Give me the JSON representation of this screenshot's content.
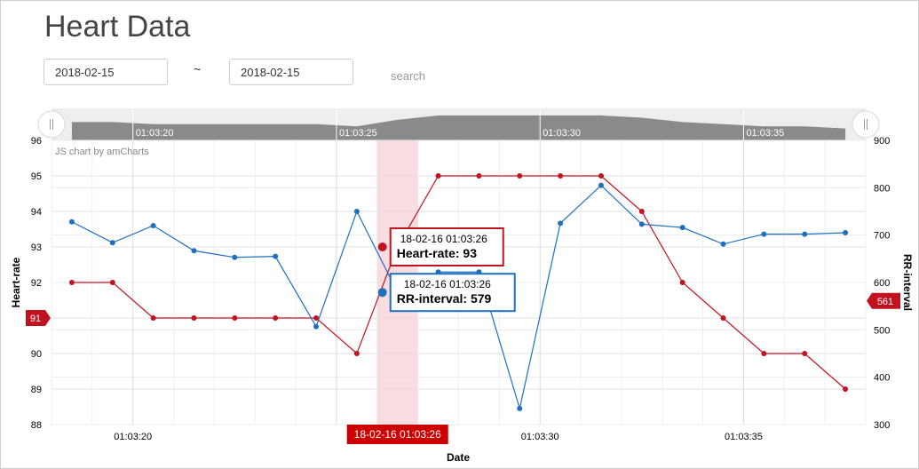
{
  "page": {
    "title": "Heart Data"
  },
  "filters": {
    "start_date": "2018-02-15",
    "end_date": "2018-02-15",
    "separator": "~",
    "search_label": "search"
  },
  "colors": {
    "heart_rate": "#c1121f",
    "rr_interval": "#1f6fbf",
    "scrollbar_fill": "#8a8a8a",
    "scrollbar_bg": "#eeeeee",
    "cursor_band": "#f6d5d8",
    "grid": "#e0e0e0"
  },
  "chart_data": {
    "type": "line",
    "credit": "JS chart by amCharts",
    "xlabel": "Date",
    "y_left_label": "Heart-rate",
    "y_right_label": "RR-interval",
    "ylim_left": [
      88,
      96
    ],
    "ylim_right": [
      300,
      900
    ],
    "y_left_ticks": [
      88,
      89,
      90,
      91,
      92,
      93,
      94,
      95,
      96
    ],
    "y_right_ticks": [
      300,
      400,
      500,
      600,
      700,
      800,
      900
    ],
    "x_tick_labels": [
      "01:03:20",
      "01:03:30",
      "01:03:35"
    ],
    "x_tick_times": [
      "01:03:20",
      "01:03:30",
      "01:03:35"
    ],
    "x_range": [
      "01:03:18",
      "01:03:38"
    ],
    "scrollbar_labels": [
      "01:03:20",
      "01:03:25",
      "01:03:30",
      "01:03:35"
    ],
    "scrollbar_label_times": [
      "01:03:20",
      "01:03:25",
      "01:03:30",
      "01:03:35"
    ],
    "x": [
      "01:03:18.5",
      "01:03:19.5",
      "01:03:20.5",
      "01:03:21.5",
      "01:03:22.5",
      "01:03:23.5",
      "01:03:24.5",
      "01:03:25.5",
      "01:03:26.5",
      "01:03:27.5",
      "01:03:28.5",
      "01:03:29.5",
      "01:03:30.5",
      "01:03:31.5",
      "01:03:32.5",
      "01:03:33.5",
      "01:03:34.5",
      "01:03:35.5",
      "01:03:36.5",
      "01:03:37.5"
    ],
    "series": [
      {
        "name": "Heart-rate",
        "axis": "left",
        "values": [
          92,
          92,
          91,
          91,
          91,
          91,
          91,
          90,
          93,
          95,
          95,
          95,
          95,
          95,
          94,
          92,
          91,
          90,
          90,
          89
        ]
      },
      {
        "name": "RR-interval",
        "axis": "right",
        "values": [
          728,
          684,
          720,
          667,
          653,
          655,
          507,
          750,
          579,
          622,
          622,
          334,
          725,
          805,
          723,
          716,
          681,
          702,
          702,
          705
        ]
      }
    ],
    "cursor": {
      "label": "18-02-16 01:03:26",
      "index": 8,
      "band_start": "01:03:26",
      "band_end": "01:03:27"
    },
    "tooltips": [
      {
        "series": "Heart-rate",
        "time": "18-02-16 01:03:26",
        "text": "Heart-rate: 93"
      },
      {
        "series": "RR-interval",
        "time": "18-02-16 01:03:26",
        "text": "RR-interval: 579"
      }
    ],
    "axis_badges": {
      "left": "91",
      "right": "561"
    }
  }
}
